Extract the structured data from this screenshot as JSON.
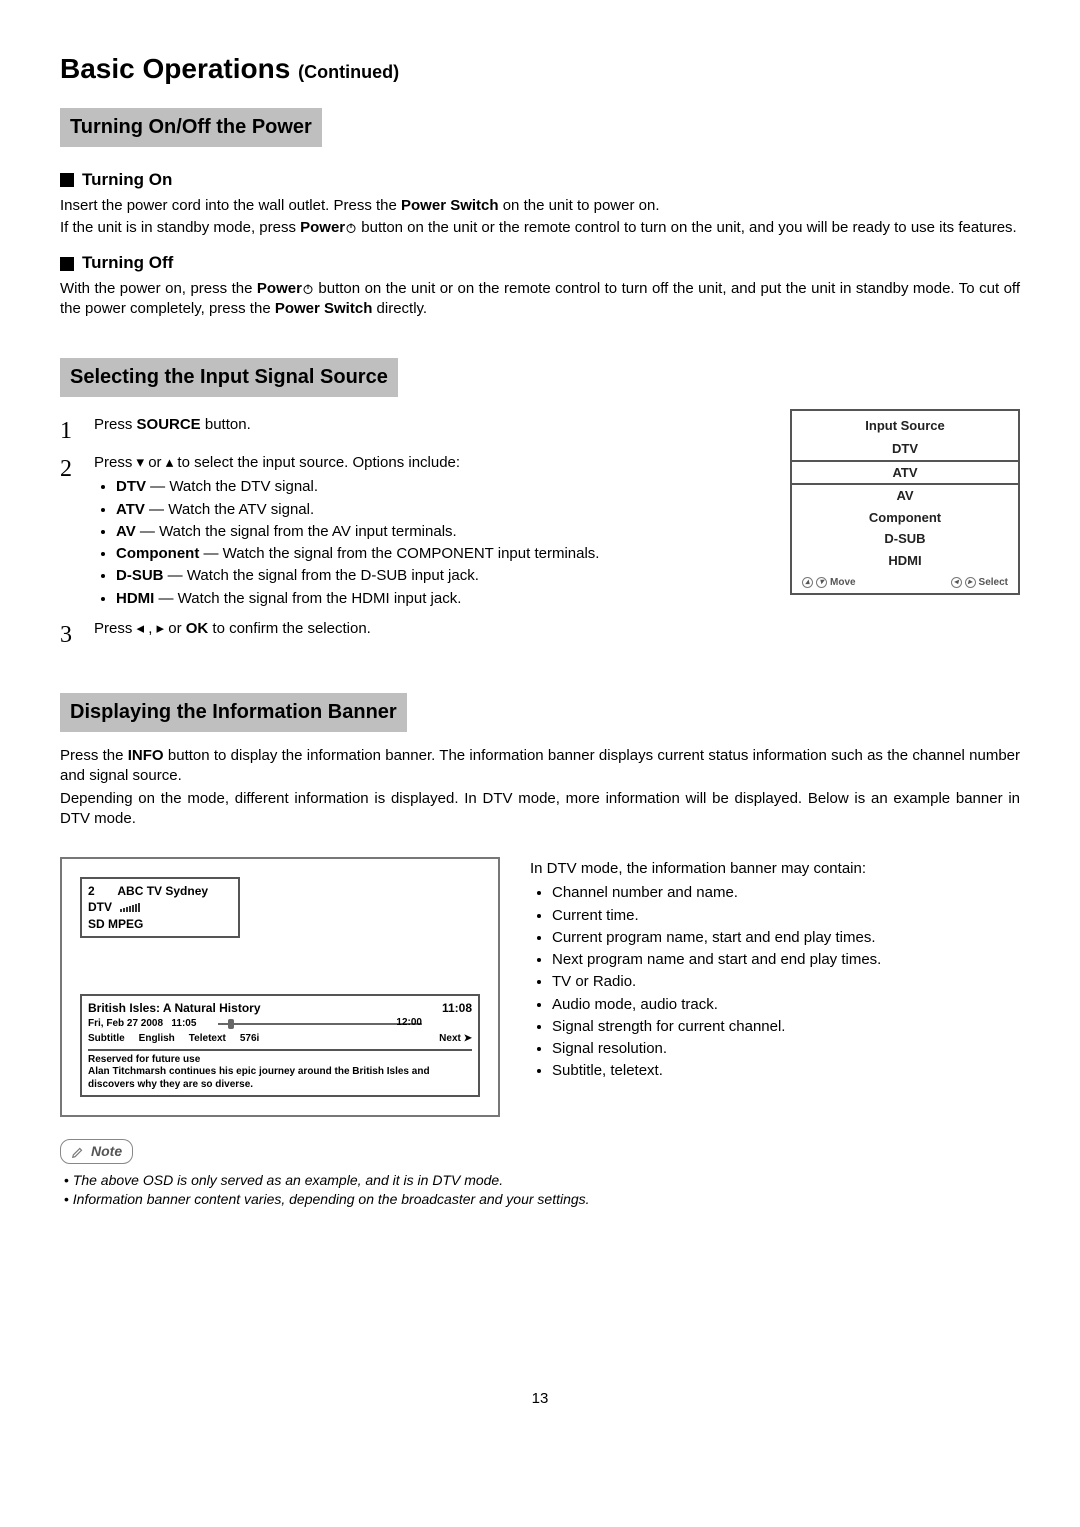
{
  "page": {
    "title_main": "Basic Operations",
    "title_sub": "(Continued)",
    "number": "13"
  },
  "sec1": {
    "heading": "Turning On/Off the Power",
    "on": {
      "heading": "Turning On",
      "p1a": "Insert the power cord into the wall outlet. Press the ",
      "p1b": "Power Switch",
      "p1c": " on the unit to power on.",
      "p2a": "If the unit is in standby mode, press ",
      "p2b": "Power",
      "p2c": " button on the unit or the remote control to turn on the unit, and you will be ready to use its features."
    },
    "off": {
      "heading": "Turning Off",
      "p1a": "With the power on, press the ",
      "p1b": "Power",
      "p1c": " button on the unit or on the remote control to turn off the unit, and put the unit in standby mode. To cut off the power completely, press the ",
      "p1d": "Power Switch",
      "p1e": " directly."
    }
  },
  "sec2": {
    "heading": "Selecting the Input Signal Source",
    "step1": {
      "num": "1",
      "a": "Press ",
      "b": "SOURCE",
      "c": " button."
    },
    "step2": {
      "num": "2",
      "intro": "Press ▾ or ▴ to select the input source. Options include:",
      "items": [
        {
          "label": "DTV",
          "desc": " — Watch the DTV signal."
        },
        {
          "label": "ATV",
          "desc": " — Watch the ATV signal."
        },
        {
          "label": "AV",
          "desc": " — Watch the signal from the AV input terminals."
        },
        {
          "label": "Component",
          "desc": " — Watch the signal from the COMPONENT input terminals."
        },
        {
          "label": "D-SUB",
          "desc": " — Watch the signal from the D-SUB input jack."
        },
        {
          "label": "HDMI",
          "desc": " — Watch the signal from the HDMI input jack."
        }
      ]
    },
    "step3": {
      "num": "3",
      "a": "Press  ◂ , ▸  or ",
      "b": "OK",
      "c": " to confirm the selection."
    },
    "osd": {
      "title": "Input Source",
      "items": [
        "DTV",
        "ATV",
        "AV",
        "Component",
        "D-SUB",
        "HDMI"
      ],
      "move": "Move",
      "select": "Select"
    }
  },
  "sec3": {
    "heading": "Displaying the Information Banner",
    "p1a": "Press the ",
    "p1b": "INFO",
    "p1c": " button to display the information banner. The information banner displays current status information such as the channel number and signal source.",
    "p2": "Depending on the mode, different information is displayed. In DTV mode, more information will be displayed. Below is an example banner in DTV mode.",
    "banner": {
      "ch_num": "2",
      "ch_name": "ABC TV Sydney",
      "source": "DTV",
      "res_line": "SD  MPEG",
      "prog_title": "British Isles: A Natural History",
      "prog_end": "11:08",
      "date": "Fri, Feb 27 2008",
      "now": "11:05",
      "next_time": "12:00",
      "labels": [
        "Subtitle",
        "English",
        "Teletext",
        "576i"
      ],
      "next_label": "Next ➤",
      "desc1": "Reserved for future use",
      "desc2": "Alan Titchmarsh continues his epic journey around the British Isles and discovers why they are so diverse."
    },
    "right": {
      "intro": "In DTV mode, the information banner may contain:",
      "items": [
        "Channel number and name.",
        "Current time.",
        "Current program name, start and end play times.",
        "Next program name and start and end play times.",
        "TV or Radio.",
        "Audio mode, audio track.",
        "Signal strength for current channel.",
        "Signal resolution.",
        "Subtitle, teletext."
      ]
    }
  },
  "note": {
    "label": "Note",
    "items": [
      "The above OSD is only served as an example, and it is in DTV mode.",
      "Information banner content varies, depending on the broadcaster and your settings."
    ]
  }
}
